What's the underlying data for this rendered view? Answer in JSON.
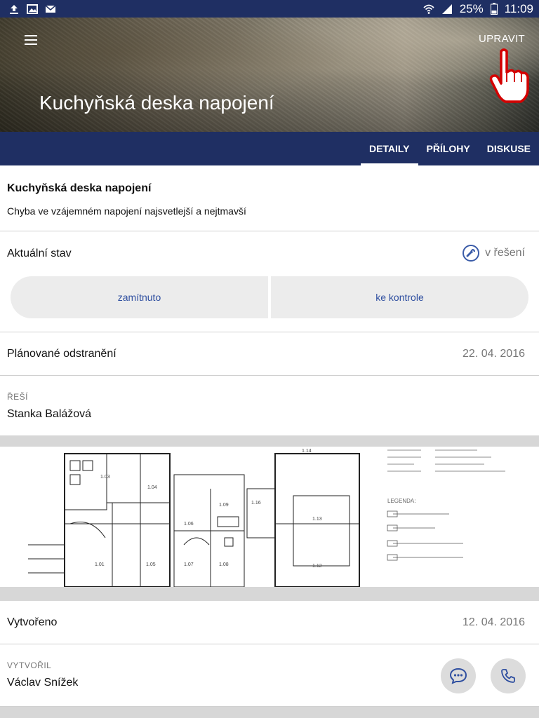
{
  "status_bar": {
    "battery": "25%",
    "time": "11:09"
  },
  "header": {
    "edit_label": "UPRAVIT",
    "title": "Kuchyňská deska napojení"
  },
  "tabs": [
    {
      "label": "DETAILY",
      "active": true
    },
    {
      "label": "PŘÍLOHY",
      "active": false
    },
    {
      "label": "DISKUSE",
      "active": false
    }
  ],
  "issue": {
    "title": "Kuchyňská deska napojení",
    "description": "Chyba ve vzájemném napojení najsvetlejší a nejtmavší"
  },
  "current_state": {
    "label": "Aktuální stav",
    "value": "v řešení",
    "icon": "wrench-icon",
    "actions": [
      "zamítnuto",
      "ke kontrole"
    ]
  },
  "planned_removal": {
    "label": "Plánované odstranění",
    "date": "22. 04. 2016"
  },
  "assignee": {
    "label": "ŘEŠÍ",
    "name": "Stanka Balážová"
  },
  "plan_labels": {
    "legend": "LEGENDA:",
    "rooms": [
      "1.14",
      "1.03",
      "1.04",
      "1.09",
      "1.16",
      "1.06",
      "1.13",
      "1.01",
      "1.05",
      "1.07",
      "1.08",
      "1.12"
    ]
  },
  "created": {
    "label": "Vytvořeno",
    "date": "12. 04. 2016"
  },
  "creator": {
    "label": "VYTVOŘIL",
    "name": "Václav Snížek"
  },
  "colors": {
    "primary": "#1f2f63",
    "accent": "#2f4fa0",
    "segment_bg": "#ececec",
    "band": "#d7d7d7"
  }
}
